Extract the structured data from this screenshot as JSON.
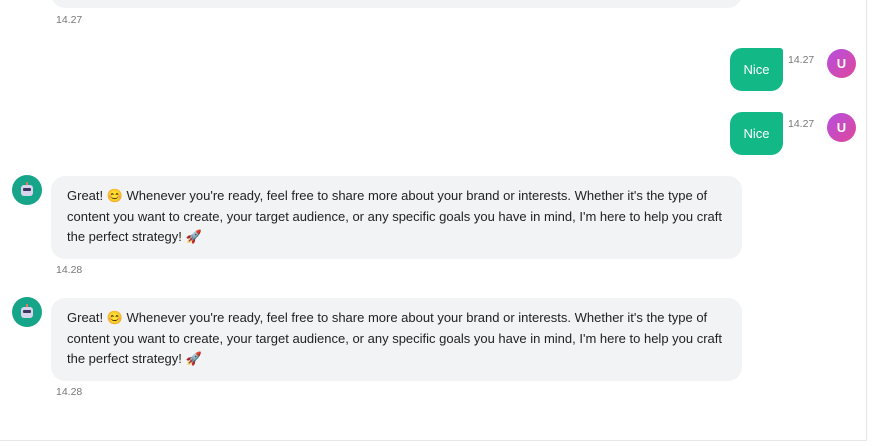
{
  "messages": [
    {
      "role": "bot",
      "text": "",
      "time": "14.27"
    },
    {
      "role": "user",
      "text": "Nice",
      "time": "14.27",
      "avatar": "U"
    },
    {
      "role": "user",
      "text": "Nice",
      "time": "14.27",
      "avatar": "U"
    },
    {
      "role": "bot",
      "text": "Great! 😊 Whenever you're ready, feel free to share more about your brand or interests. Whether it's the type of content you want to create, your target audience, or any specific goals you have in mind, I'm here to help you craft the perfect strategy! 🚀",
      "time": "14.28"
    },
    {
      "role": "bot",
      "text": "Great! 😊 Whenever you're ready, feel free to share more about your brand or interests. Whether it's the type of content you want to create, your target audience, or any specific goals you have in mind, I'm here to help you craft the perfect strategy! 🚀",
      "time": "14.28"
    }
  ],
  "colors": {
    "user_bubble": "#12b886",
    "bot_bubble": "#f2f3f5",
    "bot_avatar": "#17a589"
  }
}
